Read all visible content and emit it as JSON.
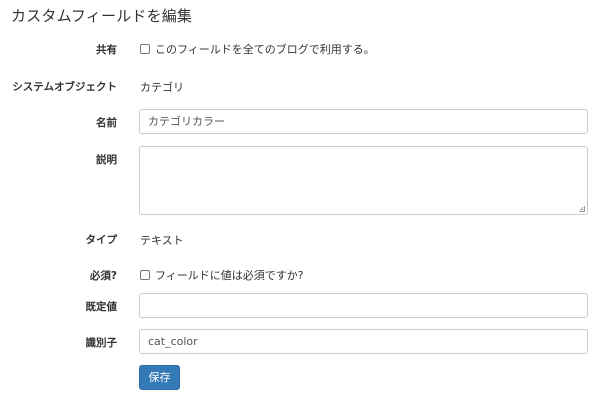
{
  "page": {
    "title": "カスタムフィールドを編集"
  },
  "form": {
    "shared": {
      "label": "共有",
      "checkbox_label": "このフィールドを全てのブログで利用する。",
      "checked": false
    },
    "system_object": {
      "label": "システムオブジェクト",
      "value": "カテゴリ"
    },
    "name": {
      "label": "名前",
      "value": "カテゴリカラー"
    },
    "description": {
      "label": "説明",
      "value": ""
    },
    "type": {
      "label": "タイプ",
      "value": "テキスト"
    },
    "required": {
      "label": "必須?",
      "checkbox_label": "フィールドに値は必須ですか?",
      "checked": false
    },
    "default_value": {
      "label": "既定値",
      "value": ""
    },
    "identifier": {
      "label": "識別子",
      "value": "cat_color"
    },
    "save_label": "保存"
  },
  "colors": {
    "primary_button": "#337ab7",
    "input_border": "#cccccc"
  }
}
